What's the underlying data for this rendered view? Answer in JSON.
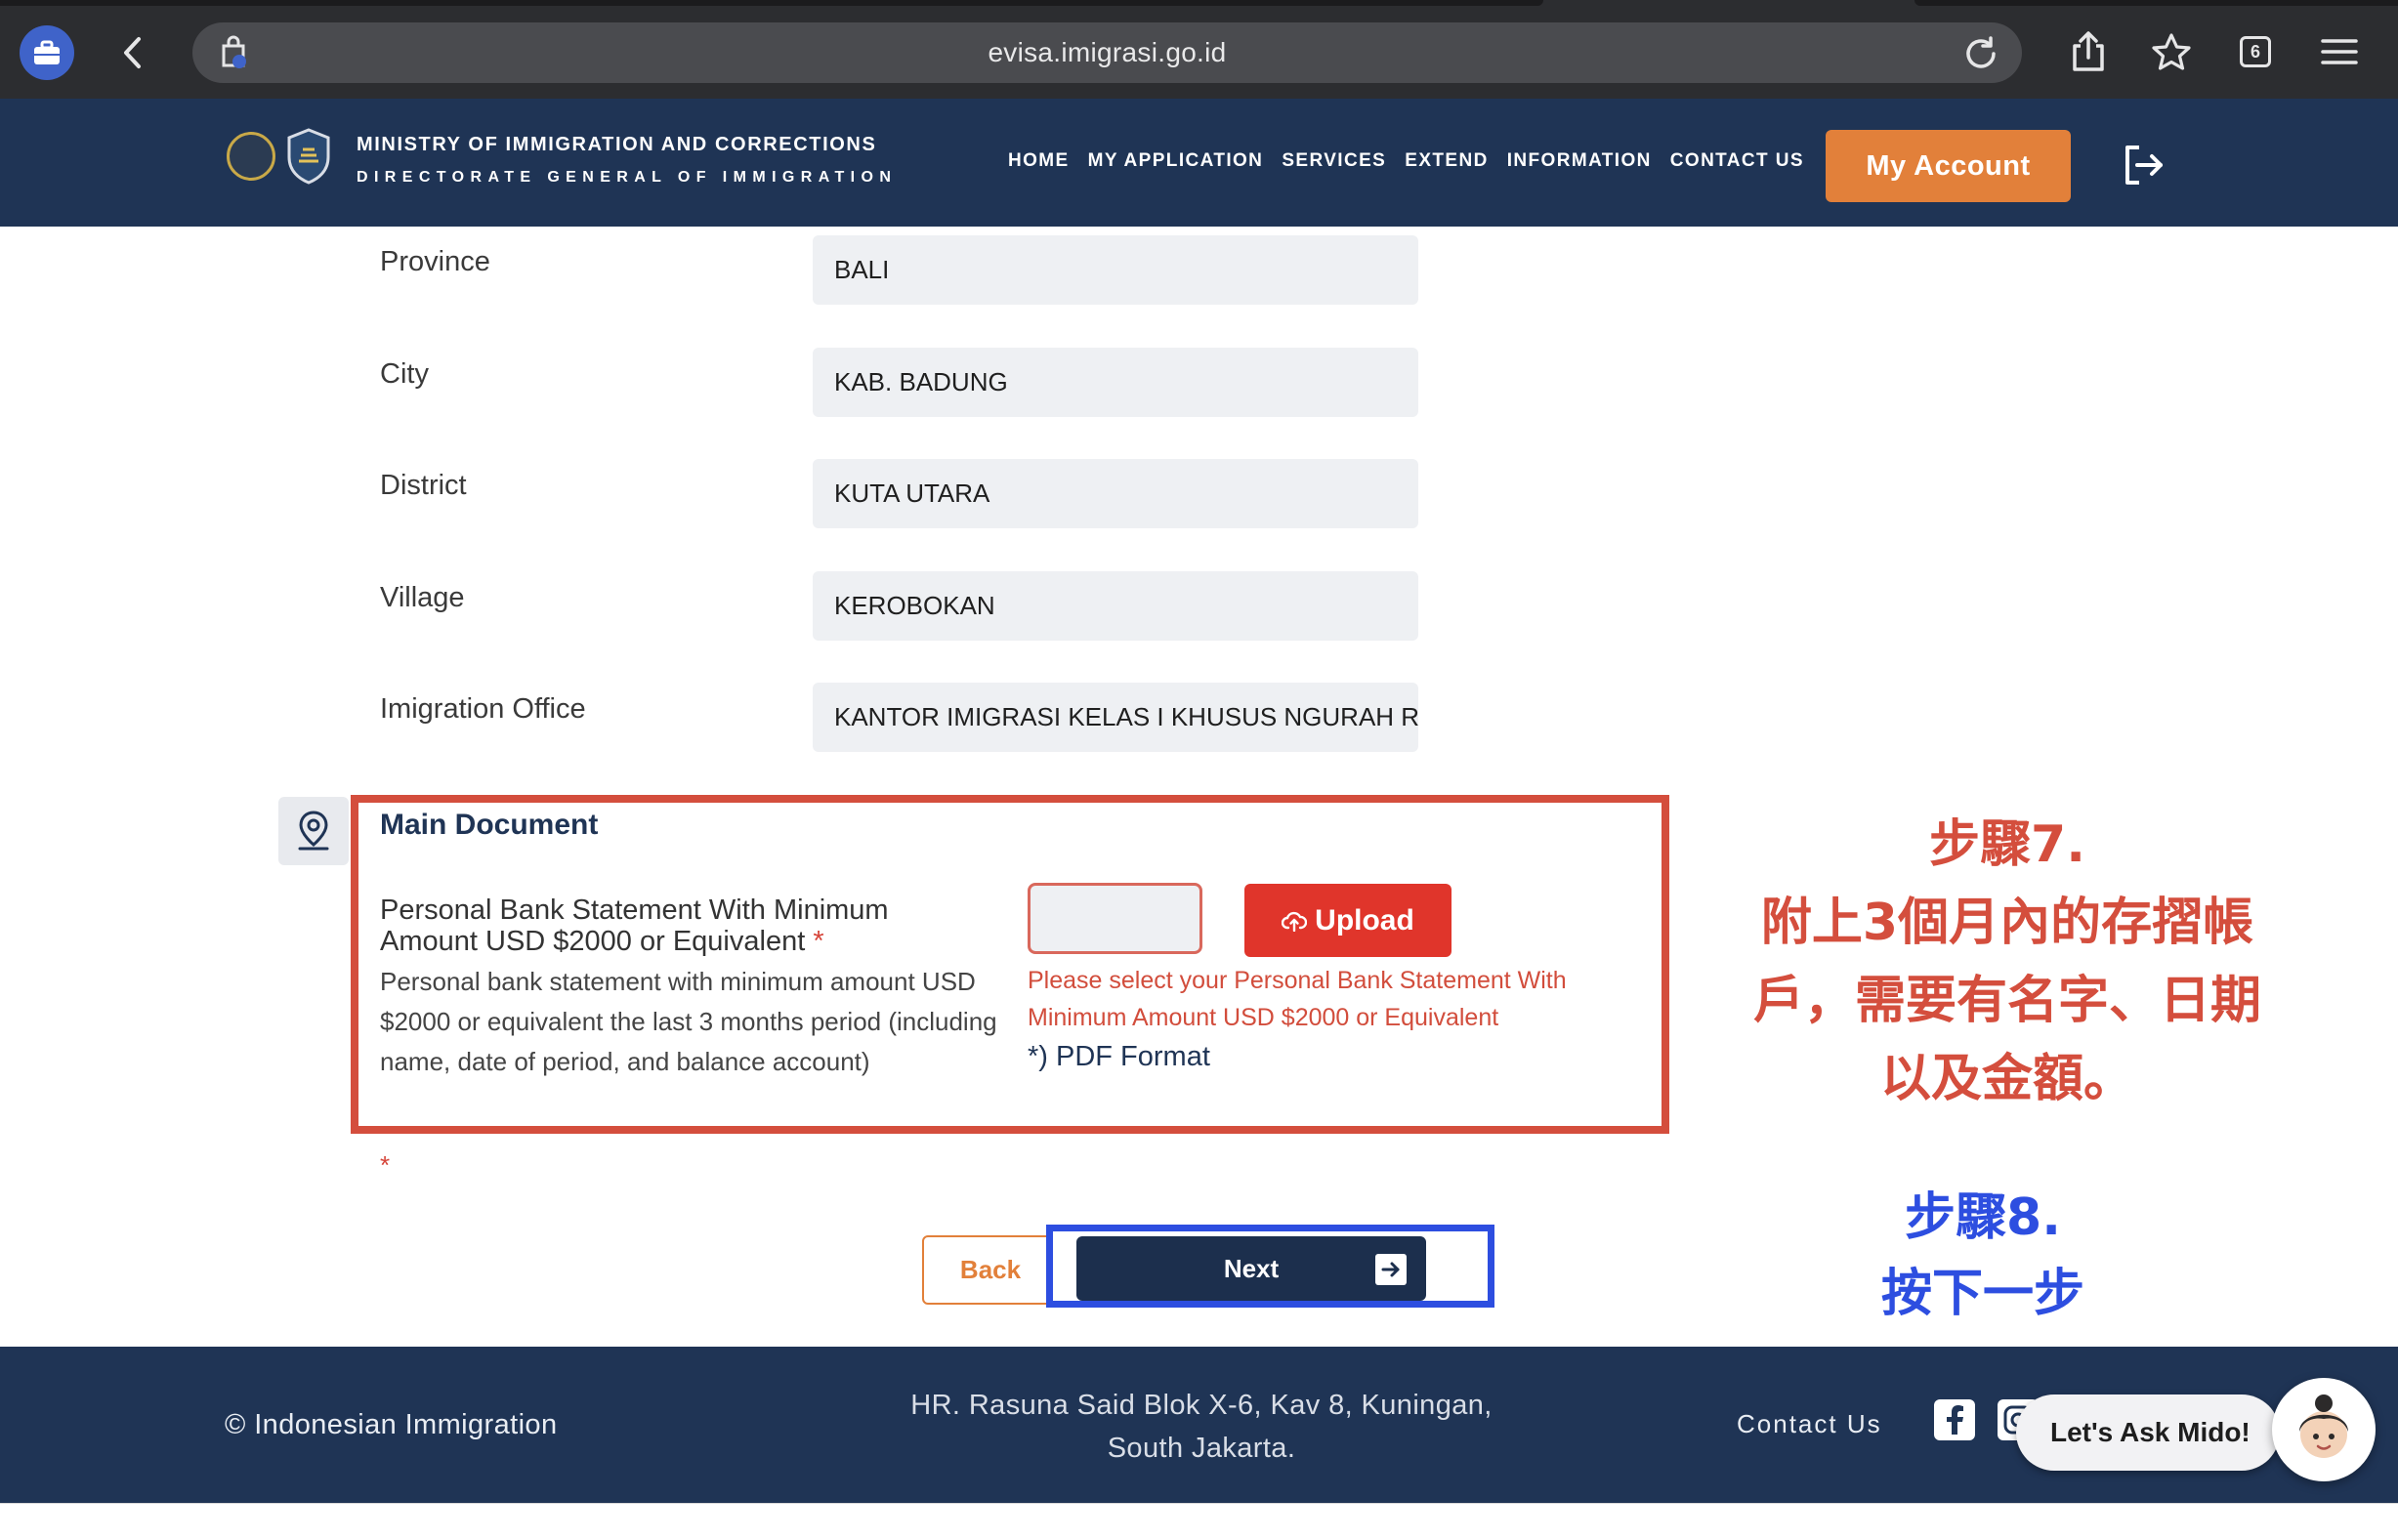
{
  "browser": {
    "url": "evisa.imigrasi.go.id",
    "tab_count": "6"
  },
  "header": {
    "ministry": "MINISTRY OF IMMIGRATION AND CORRECTIONS",
    "directorate": "DIRECTORATE GENERAL OF IMMIGRATION",
    "nav": [
      "HOME",
      "MY APPLICATION",
      "SERVICES",
      "EXTEND",
      "INFORMATION",
      "CONTACT US"
    ],
    "account_button": "My Account"
  },
  "form": {
    "fields": [
      {
        "label": "Province",
        "value": "BALI"
      },
      {
        "label": "City",
        "value": "KAB. BADUNG"
      },
      {
        "label": "District",
        "value": "KUTA UTARA"
      },
      {
        "label": "Village",
        "value": "KEROBOKAN"
      },
      {
        "label": "Imigration Office",
        "value": "KANTOR IMIGRASI KELAS I KHUSUS NGURAH RAI"
      }
    ]
  },
  "main_document": {
    "title": "Main Document",
    "doc_name": "Personal Bank Statement With Minimum Amount USD $2000 or Equivalent",
    "required_mark": "*",
    "description": "Personal bank statement with minimum amount USD $2000 or equivalent the last 3 months period (including name, date of period, and balance account)",
    "upload_label": "Upload",
    "error": "Please select your Personal Bank Statement With Minimum Amount USD $2000 or Equivalent",
    "format_note": "*) PDF Format"
  },
  "buttons": {
    "back": "Back",
    "next": "Next"
  },
  "annotations": {
    "step7_title": "步驟7.",
    "step7_line1": "附上3個月內的存摺帳",
    "step7_line2": "戶，需要有名字、日期",
    "step7_line3": "以及金額。",
    "step8_title": "步驟8.",
    "step8_line1": "按下一步"
  },
  "footer": {
    "copyright": "© Indonesian Immigration",
    "address_line1": "HR. Rasuna Said Blok X-6, Kav 8, Kuningan,",
    "address_line2": "South Jakarta.",
    "contact": "Contact Us",
    "chat_label": "Let's Ask Mido!"
  },
  "colors": {
    "navy": "#1f3455",
    "orange": "#e2803a",
    "upload_red": "#e0352b",
    "annotation_red": "#d44e3d",
    "annotation_blue": "#2d4ee0"
  }
}
